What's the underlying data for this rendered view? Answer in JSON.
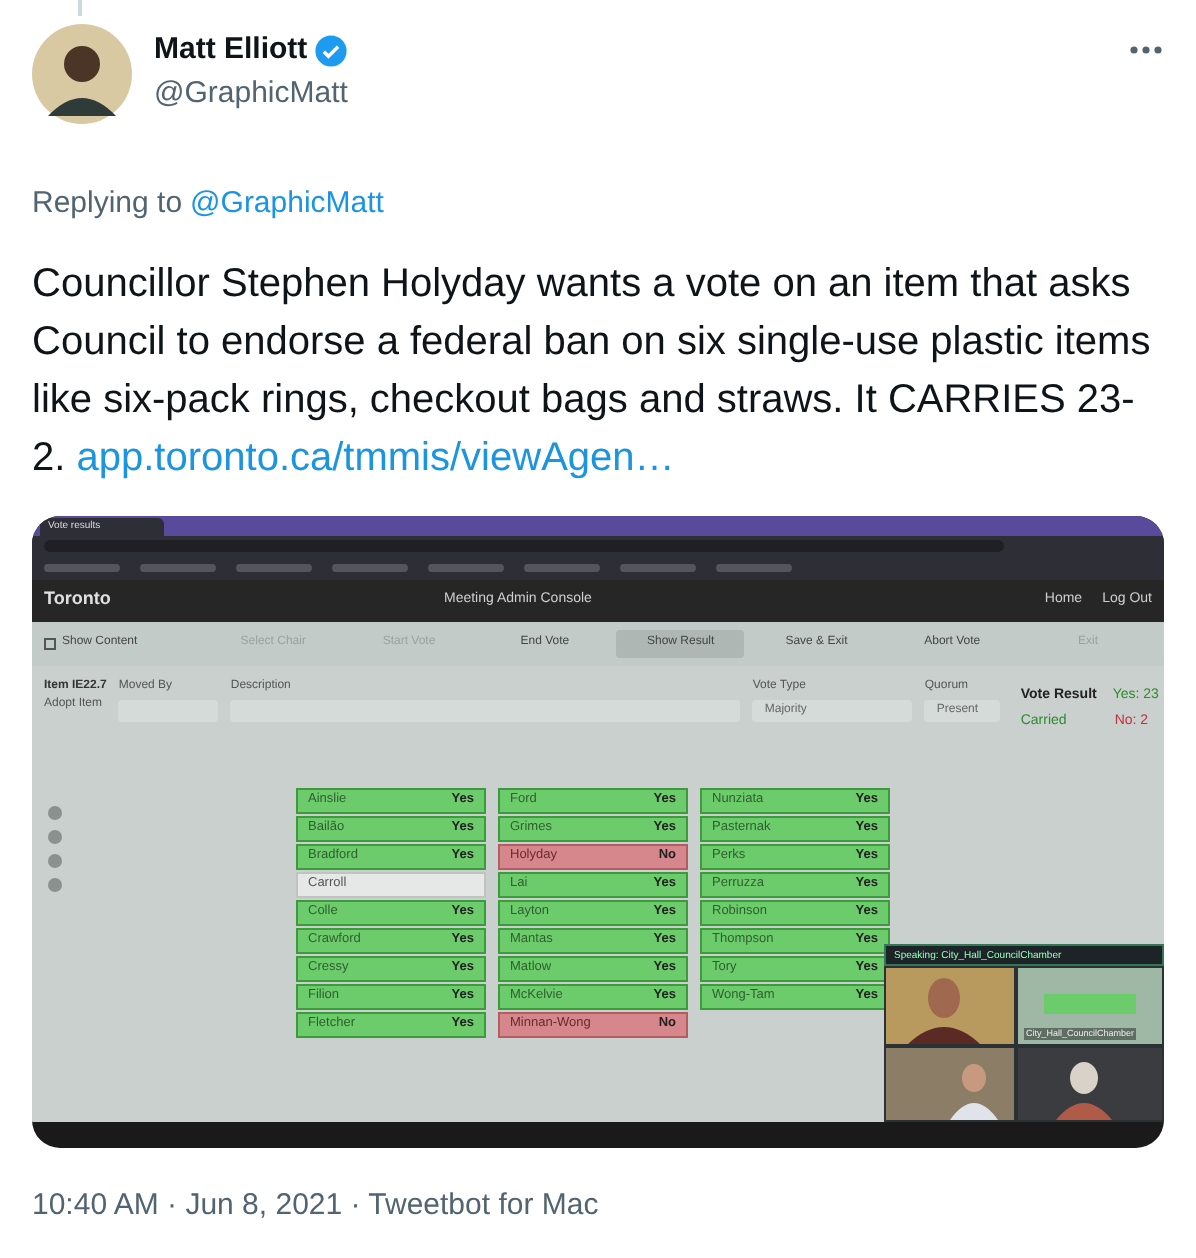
{
  "tweet": {
    "author": {
      "name": "Matt Elliott",
      "handle": "@GraphicMatt",
      "verified": true
    },
    "replying_to": {
      "label": "Replying to",
      "handle": "@GraphicMatt"
    },
    "text": "Councillor Stephen Holyday wants a vote on an item that asks Council to endorse a federal ban on six single-use plastic items like six-pack rings, checkout bags and straws. It CARRIES 23-2.",
    "link": "app.toronto.ca/tmmis/viewAgen…",
    "footer": "10:40 AM · Jun 8, 2021 · Tweetbot for Mac"
  },
  "image": {
    "browser": {
      "tab_title": "Vote results"
    },
    "console": {
      "brand": "Toronto",
      "title": "Meeting Admin Console",
      "nav": [
        "Home",
        "Log Out"
      ],
      "show_content": {
        "label": "Show Content",
        "checked": false
      },
      "actions": [
        {
          "label": "Select Chair",
          "disabled": true
        },
        {
          "label": "Start Vote",
          "disabled": true
        },
        {
          "label": "End Vote",
          "disabled": false
        },
        {
          "label": "Show Result",
          "disabled": false,
          "selected": true
        },
        {
          "label": "Save & Exit",
          "disabled": false
        },
        {
          "label": "Abort Vote",
          "disabled": false
        },
        {
          "label": "Exit",
          "disabled": true
        }
      ],
      "item": {
        "id": "Item IE22.7",
        "action": "Adopt Item"
      },
      "moved_by": {
        "label": "Moved By"
      },
      "description": {
        "label": "Description"
      },
      "vote_type": {
        "label": "Vote Type",
        "value": "Majority"
      },
      "quorum": {
        "label": "Quorum",
        "value": "Present"
      },
      "result": {
        "label": "Vote Result",
        "outcome": "Carried",
        "yes": "Yes: 23",
        "no": "No: 2"
      },
      "vote_columns": [
        [
          {
            "name": "Ainslie",
            "kind": "yes",
            "vote": "Yes"
          },
          {
            "name": "Bailão",
            "kind": "yes",
            "vote": "Yes"
          },
          {
            "name": "Bradford",
            "kind": "yes",
            "vote": "Yes"
          },
          {
            "name": "Carroll",
            "kind": "absent"
          },
          {
            "name": "Colle",
            "kind": "yes",
            "vote": "Yes"
          },
          {
            "name": "Crawford",
            "kind": "yes",
            "vote": "Yes"
          },
          {
            "name": "Cressy",
            "kind": "yes",
            "vote": "Yes"
          },
          {
            "name": "Filion",
            "kind": "yes",
            "vote": "Yes"
          },
          {
            "name": "Fletcher",
            "kind": "yes",
            "vote": "Yes"
          }
        ],
        [
          {
            "name": "Ford",
            "kind": "yes",
            "vote": "Yes"
          },
          {
            "name": "Grimes",
            "kind": "yes",
            "vote": "Yes"
          },
          {
            "name": "Holyday",
            "kind": "no",
            "vote": "No"
          },
          {
            "name": "Lai",
            "kind": "yes",
            "vote": "Yes"
          },
          {
            "name": "Layton",
            "kind": "yes",
            "vote": "Yes"
          },
          {
            "name": "Mantas",
            "kind": "yes",
            "vote": "Yes"
          },
          {
            "name": "Matlow",
            "kind": "yes",
            "vote": "Yes"
          },
          {
            "name": "McKelvie",
            "kind": "yes",
            "vote": "Yes"
          },
          {
            "name": "Minnan-Wong",
            "kind": "no",
            "vote": "No"
          }
        ],
        [
          {
            "name": "Nunziata",
            "kind": "yes",
            "vote": "Yes"
          },
          {
            "name": "Pasternak",
            "kind": "yes",
            "vote": "Yes"
          },
          {
            "name": "Perks",
            "kind": "yes",
            "vote": "Yes"
          },
          {
            "name": "Perruzza",
            "kind": "yes",
            "vote": "Yes"
          },
          {
            "name": "Robinson",
            "kind": "yes",
            "vote": "Yes"
          },
          {
            "name": "Thompson",
            "kind": "yes",
            "vote": "Yes"
          },
          {
            "name": "Tory",
            "kind": "yes",
            "vote": "Yes"
          },
          {
            "name": "Wong-Tam",
            "kind": "yes",
            "vote": "Yes"
          }
        ]
      ]
    },
    "video": {
      "speaking": "Speaking: City_Hall_CouncilChamber",
      "tile_label": "City_Hall_CouncilChamber"
    }
  }
}
